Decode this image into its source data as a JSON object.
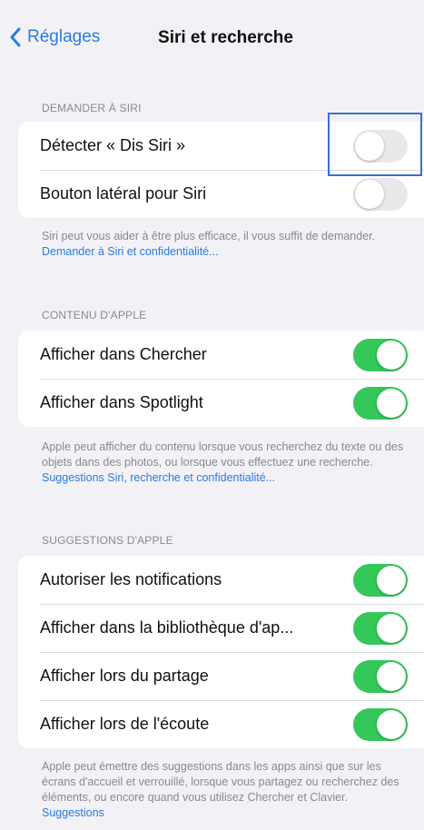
{
  "nav": {
    "back_label": "Réglages",
    "title": "Siri et recherche"
  },
  "sections": {
    "ask_siri": {
      "header": "DEMANDER À SIRI",
      "rows": [
        {
          "label": "Détecter « Dis Siri »",
          "on": false
        },
        {
          "label": "Bouton latéral pour Siri",
          "on": false
        }
      ],
      "footer_text": "Siri peut vous aider à être plus efficace, il vous suffit de demander. ",
      "footer_link": "Demander à Siri et confidentialité..."
    },
    "apple_content": {
      "header": "CONTENU D'APPLE",
      "rows": [
        {
          "label": "Afficher dans Chercher",
          "on": true
        },
        {
          "label": "Afficher dans Spotlight",
          "on": true
        }
      ],
      "footer_text": "Apple peut afficher du contenu lorsque vous recherchez du texte ou des objets dans des photos, ou lorsque vous effectuez une recherche. ",
      "footer_link": "Suggestions Siri, recherche et confidentialité..."
    },
    "apple_suggestions": {
      "header": "SUGGESTIONS D'APPLE",
      "rows": [
        {
          "label": "Autoriser les notifications",
          "on": true
        },
        {
          "label": "Afficher dans la bibliothèque d'ap...",
          "on": true
        },
        {
          "label": "Afficher lors du partage",
          "on": true
        },
        {
          "label": "Afficher lors de l'écoute",
          "on": true
        }
      ],
      "footer_text": "Apple peut émettre des suggestions dans les apps ainsi que sur les écrans d'accueil et verrouillé, lorsque vous partagez ou recherchez des éléments, ou encore quand vous utilisez Chercher et Clavier. ",
      "footer_link": "Suggestions"
    }
  },
  "colors": {
    "accent": "#2a7ae4",
    "toggle_on": "#34c759",
    "toggle_off": "#e9e9eb",
    "highlight": "#3b6fd4"
  }
}
